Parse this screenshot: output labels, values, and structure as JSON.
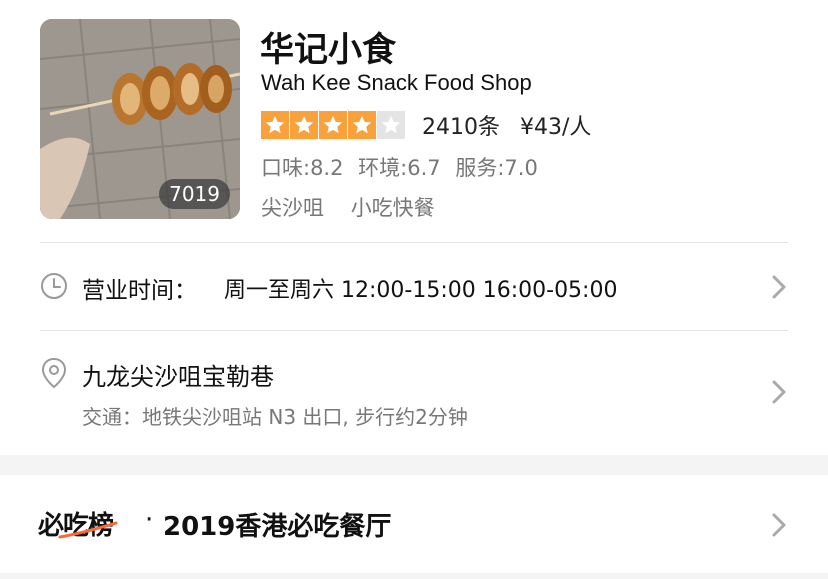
{
  "shop": {
    "name_cn": "华记小食",
    "name_en": "Wah Kee Snack Food Shop",
    "photo_count": "7019",
    "rating_stars": 4,
    "rating_max": 5,
    "review_count": "2410条",
    "price": "¥43/人",
    "scores": {
      "taste": "口味:8.2",
      "environment": "环境:6.7",
      "service": "服务:7.0"
    },
    "tags": [
      "尖沙咀",
      "小吃快餐"
    ]
  },
  "hours": {
    "label": "营业时间：",
    "value": "周一至周六 12:00-15:00 16:00-05:00"
  },
  "address": {
    "main": "九龙尖沙咀宝勒巷",
    "transit": "交通：地铁尖沙咀站 N3 出口, 步行约2分钟"
  },
  "ranking": {
    "logo_text": "必吃榜",
    "dot": "·",
    "title": "2019香港必吃餐厅"
  },
  "icons": {
    "clock": "clock-icon",
    "location": "location-pin-icon",
    "chevron": "chevron-right-icon"
  },
  "colors": {
    "star_on": "#f9a13a",
    "star_off": "#e4e4e4",
    "accent_orange": "#ff6633"
  }
}
